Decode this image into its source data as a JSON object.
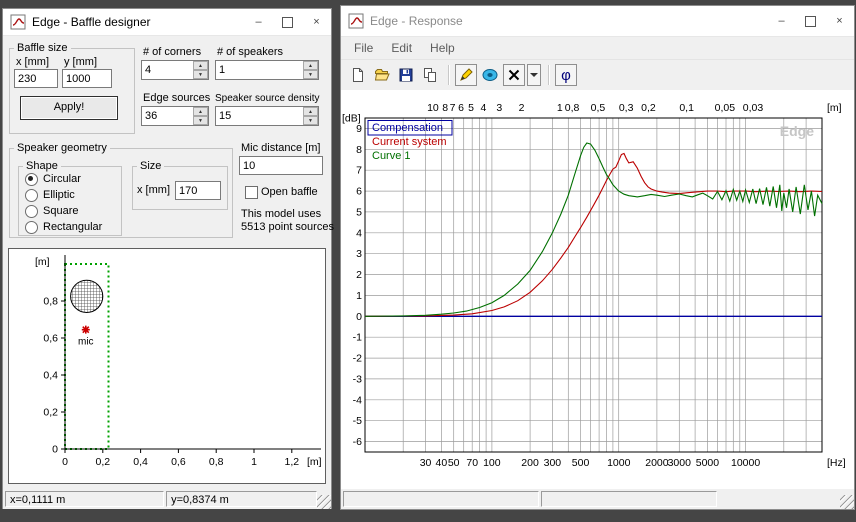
{
  "window_controls": {
    "minimize": "–",
    "close": "×"
  },
  "baffle_window": {
    "title": "Edge - Baffle designer",
    "groups": {
      "baffle_size": {
        "legend": "Baffle size",
        "x_label": "x [mm]",
        "x_value": "230",
        "y_label": "y [mm]",
        "y_value": "1000",
        "apply_label": "Apply!"
      },
      "corners": {
        "label": "# of corners",
        "value": "4"
      },
      "speakers": {
        "label": "# of speakers",
        "value": "1"
      },
      "edge_sources": {
        "label": "Edge sources",
        "value": "36"
      },
      "source_density": {
        "label": "Speaker source density",
        "value": "15"
      },
      "speaker_geometry": {
        "legend": "Speaker geometry",
        "shape": {
          "legend": "Shape",
          "options": [
            "Circular",
            "Elliptic",
            "Square",
            "Rectangular"
          ],
          "selected": "Circular"
        },
        "size": {
          "legend": "Size",
          "x_label": "x [mm]",
          "x_value": "170"
        }
      },
      "mic_distance": {
        "label": "Mic distance [m]",
        "value": "10"
      },
      "open_baffle": {
        "label": "Open baffle",
        "checked": false
      },
      "model_info": [
        "This model uses",
        "5513 point sources"
      ]
    },
    "plot": {
      "y_unit": "[m]",
      "x_unit": "[m]",
      "y_ticks": [
        "0,8",
        "0,6",
        "0,4",
        "0,2",
        "0"
      ],
      "y_tick_values": [
        0.8,
        0.6,
        0.4,
        0.2,
        0
      ],
      "x_ticks": [
        "0",
        "0,2",
        "0,4",
        "0,6",
        "0,8",
        "1",
        "1,2"
      ],
      "x_tick_values": [
        0,
        0.2,
        0.4,
        0.6,
        0.8,
        1.0,
        1.2
      ],
      "baffle": {
        "width_m": 0.23,
        "height_m": 1.0,
        "border_color": "#00a000"
      },
      "speaker": {
        "cx_m": 0.115,
        "cy_m": 0.825,
        "diameter_m": 0.17
      },
      "mic": {
        "x_m": 0.11,
        "y_m": 0.645,
        "label": "mic",
        "color": "#cc0000"
      }
    },
    "statusbar": {
      "x_text": "x=0,1111 m",
      "y_text": "y=0,8374 m"
    }
  },
  "response_window": {
    "title": "Edge - Response",
    "menu": [
      "File",
      "Edit",
      "Help"
    ],
    "toolbar": {
      "phi_label": "φ",
      "icon_names": [
        "new-document-icon",
        "open-folder-icon",
        "save-icon",
        "copy-icon",
        "pen-icon",
        "speaker-icon",
        "delete-curve-icon",
        "dropdown-arrow-icon",
        "phase-button"
      ]
    }
  },
  "chart_data": {
    "type": "line",
    "watermark": "Edge",
    "watermark_color": "#c6c6c6",
    "grid_color": "#9c9c9c",
    "x_axis": {
      "scale": "log",
      "f_min": 10,
      "f_max": 40000,
      "unit": "[Hz]",
      "tick_labels": [
        "30",
        "40",
        "50",
        "70",
        "100",
        "200",
        "300",
        "500",
        "1000",
        "2000",
        "3000",
        "5000",
        "10000"
      ],
      "tick_values": [
        30,
        40,
        50,
        70,
        100,
        200,
        300,
        500,
        1000,
        2000,
        3000,
        5000,
        10000
      ]
    },
    "top_axis": {
      "unit": "[m]",
      "speed_of_sound": 343,
      "tick_labels": [
        "10",
        "8",
        "7",
        "6",
        "5",
        "4",
        "3",
        "2",
        "1",
        "0,8",
        "0,5",
        "0,3",
        "0,2",
        "0,1",
        "0,05",
        "0,03"
      ],
      "tick_values": [
        10,
        8,
        7,
        6,
        5,
        4,
        3,
        2,
        1,
        0.8,
        0.5,
        0.3,
        0.2,
        0.1,
        0.05,
        0.03
      ]
    },
    "y_axis": {
      "unit": "[dB]",
      "view_min": -6.5,
      "view_max": 9.5,
      "ticks": [
        9,
        8,
        7,
        6,
        5,
        4,
        3,
        2,
        1,
        0,
        -1,
        -2,
        -3,
        -4,
        -5,
        -6
      ]
    },
    "legend_position": "top-left",
    "series": [
      {
        "name": "Compensation",
        "color": "#0000a0",
        "width": 1.4,
        "points": [
          [
            10,
            0
          ],
          [
            40000,
            0
          ]
        ]
      },
      {
        "name": "Current system",
        "color": "#bb0000",
        "width": 1.1,
        "points": [
          [
            10,
            0
          ],
          [
            30,
            0.02
          ],
          [
            50,
            0.06
          ],
          [
            70,
            0.12
          ],
          [
            100,
            0.28
          ],
          [
            125,
            0.45
          ],
          [
            160,
            0.75
          ],
          [
            200,
            1.15
          ],
          [
            250,
            1.7
          ],
          [
            300,
            2.25
          ],
          [
            350,
            2.8
          ],
          [
            400,
            3.3
          ],
          [
            450,
            3.8
          ],
          [
            500,
            4.25
          ],
          [
            560,
            4.75
          ],
          [
            630,
            5.3
          ],
          [
            700,
            5.8
          ],
          [
            800,
            6.5
          ],
          [
            850,
            6.8
          ],
          [
            900,
            7.05
          ],
          [
            950,
            7.15
          ],
          [
            1000,
            7.45
          ],
          [
            1050,
            7.75
          ],
          [
            1100,
            7.8
          ],
          [
            1150,
            7.55
          ],
          [
            1200,
            7.35
          ],
          [
            1300,
            7.4
          ],
          [
            1400,
            7.1
          ],
          [
            1500,
            6.7
          ],
          [
            1600,
            6.4
          ],
          [
            1700,
            6.2
          ],
          [
            1800,
            6.1
          ],
          [
            2000,
            6.0
          ],
          [
            2200,
            5.95
          ],
          [
            2500,
            5.9
          ],
          [
            3000,
            5.88
          ],
          [
            3500,
            5.92
          ],
          [
            4000,
            5.95
          ],
          [
            5000,
            6.0
          ],
          [
            6000,
            6.0
          ],
          [
            7000,
            5.97
          ],
          [
            8000,
            6.0
          ],
          [
            10000,
            6.0
          ],
          [
            12000,
            5.97
          ],
          [
            15000,
            6.0
          ],
          [
            18000,
            5.98
          ],
          [
            22000,
            6.0
          ],
          [
            27000,
            5.97
          ],
          [
            33000,
            6.0
          ],
          [
            40000,
            5.98
          ]
        ]
      },
      {
        "name": "Curve 1",
        "color": "#007000",
        "width": 1.1,
        "points": [
          [
            10,
            0
          ],
          [
            20,
            0.02
          ],
          [
            30,
            0.05
          ],
          [
            40,
            0.1
          ],
          [
            50,
            0.16
          ],
          [
            63,
            0.25
          ],
          [
            80,
            0.42
          ],
          [
            100,
            0.65
          ],
          [
            125,
            1.0
          ],
          [
            160,
            1.55
          ],
          [
            200,
            2.2
          ],
          [
            250,
            3.1
          ],
          [
            300,
            4.0
          ],
          [
            350,
            4.9
          ],
          [
            400,
            5.8
          ],
          [
            450,
            6.8
          ],
          [
            500,
            7.7
          ],
          [
            530,
            8.1
          ],
          [
            560,
            8.3
          ],
          [
            600,
            8.25
          ],
          [
            650,
            7.95
          ],
          [
            700,
            7.55
          ],
          [
            750,
            7.15
          ],
          [
            800,
            6.8
          ],
          [
            850,
            6.55
          ],
          [
            900,
            6.3
          ],
          [
            1000,
            6.0
          ],
          [
            1100,
            5.85
          ],
          [
            1200,
            5.78
          ],
          [
            1400,
            5.72
          ],
          [
            1600,
            5.78
          ],
          [
            1800,
            5.84
          ],
          [
            2000,
            5.8
          ],
          [
            2300,
            5.74
          ],
          [
            2600,
            5.8
          ],
          [
            3000,
            5.86
          ],
          [
            3400,
            5.78
          ],
          [
            3800,
            5.72
          ],
          [
            4200,
            5.82
          ],
          [
            4600,
            5.9
          ],
          [
            5000,
            5.78
          ],
          [
            5500,
            5.62
          ],
          [
            6000,
            5.98
          ],
          [
            6500,
            5.58
          ],
          [
            7000,
            6.02
          ],
          [
            7500,
            5.52
          ],
          [
            8000,
            6.08
          ],
          [
            8500,
            5.56
          ],
          [
            9000,
            6.0
          ],
          [
            9500,
            5.5
          ],
          [
            10000,
            6.05
          ],
          [
            10700,
            5.45
          ],
          [
            11400,
            6.1
          ],
          [
            12100,
            5.4
          ],
          [
            12900,
            6.12
          ],
          [
            13700,
            5.35
          ],
          [
            14600,
            6.18
          ],
          [
            15500,
            5.28
          ],
          [
            16500,
            6.22
          ],
          [
            17500,
            5.2
          ],
          [
            18600,
            6.3
          ],
          [
            19300,
            5.05
          ],
          [
            20000,
            5.9
          ],
          [
            21000,
            5.2
          ],
          [
            22000,
            6.1
          ],
          [
            23500,
            5.0
          ],
          [
            25000,
            6.2
          ],
          [
            27000,
            4.9
          ],
          [
            29000,
            6.3
          ],
          [
            31000,
            5.1
          ],
          [
            33000,
            6.0
          ],
          [
            35000,
            4.8
          ],
          [
            37000,
            5.8
          ],
          [
            40000,
            5.4
          ]
        ]
      }
    ]
  }
}
